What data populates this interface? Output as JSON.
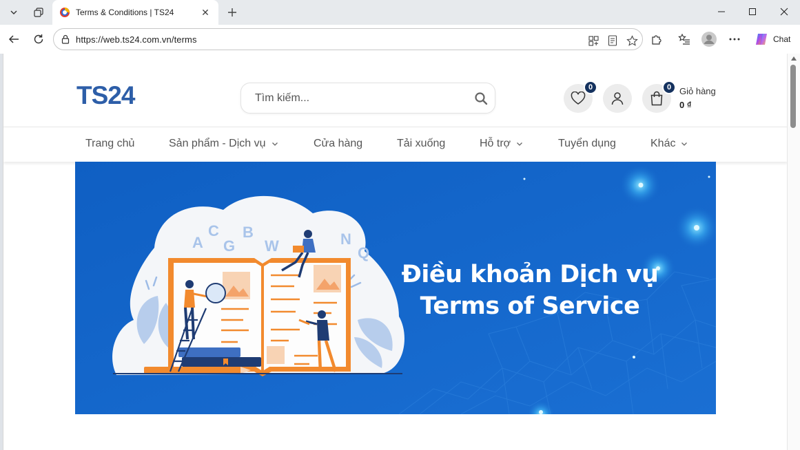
{
  "browser": {
    "tab_title": "Terms & Conditions | TS24",
    "url": "https://web.ts24.com.vn/terms",
    "chat_label": "Chat"
  },
  "header": {
    "logo_text": "TS24",
    "search_placeholder": "Tìm kiếm...",
    "wishlist_count": "0",
    "cart_count": "0",
    "cart_label": "Giỏ hàng",
    "cart_total": "0 ₫"
  },
  "menu": {
    "items": [
      {
        "label": "Trang chủ",
        "dropdown": false
      },
      {
        "label": "Sản phẩm - Dịch vụ",
        "dropdown": true
      },
      {
        "label": "Cửa hàng",
        "dropdown": false
      },
      {
        "label": "Tải xuống",
        "dropdown": false
      },
      {
        "label": "Hỗ trợ",
        "dropdown": true
      },
      {
        "label": "Tuyển dụng",
        "dropdown": false
      },
      {
        "label": "Khác",
        "dropdown": true
      }
    ]
  },
  "banner": {
    "title_vi": "Điều khoản Dịch vụ",
    "title_en": "Terms of Service",
    "letters": [
      "A",
      "C",
      "G",
      "B",
      "W",
      "N",
      "Q"
    ]
  },
  "colors": {
    "brand_blue": "#2d5ea8",
    "banner_blue": "#1266c9",
    "badge_navy": "#15325f",
    "illustration_orange": "#f28a2e"
  },
  "icons": [
    "chevron-down-icon",
    "workspaces-icon",
    "plus-icon",
    "back-arrow-icon",
    "refresh-icon",
    "site-info-icon",
    "heart-icon",
    "user-icon",
    "shopping-bag-icon",
    "search-icon"
  ]
}
